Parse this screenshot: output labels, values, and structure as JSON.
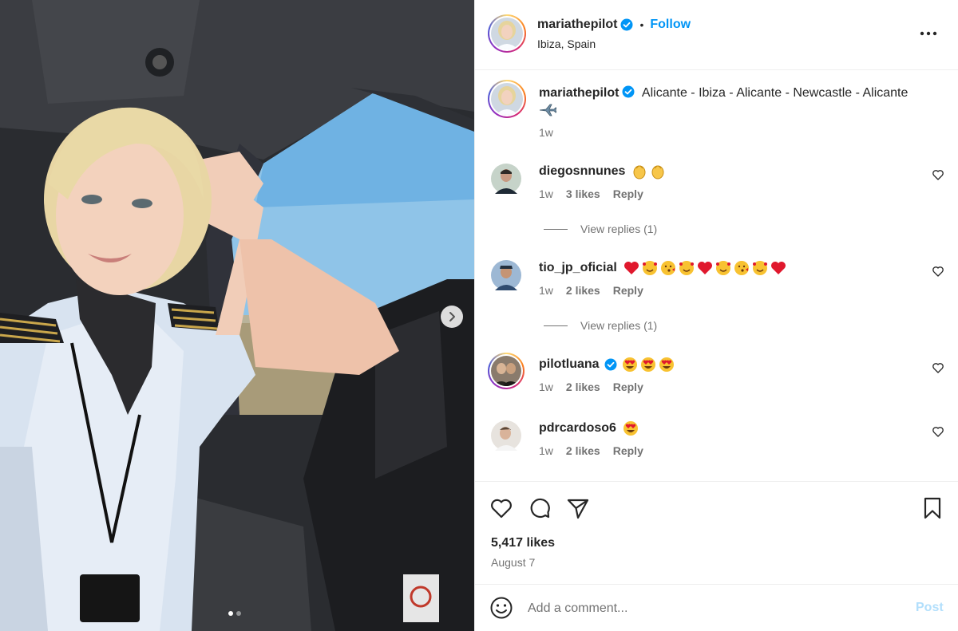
{
  "colors": {
    "accent": "#0095f6",
    "verified": "#0095f6",
    "muted": "#737373",
    "post_disabled": "#b2dffc"
  },
  "photo": {
    "alt_icon": "cockpit-selfie-photo",
    "carousel_dots": 2,
    "active_dot": 0
  },
  "header": {
    "username": "mariathepilot",
    "separator": "•",
    "follow_label": "Follow",
    "location": "Ibiza, Spain"
  },
  "caption": {
    "username": "mariathepilot",
    "text": "Alicante - Ibiza - Alicante - Newcastle - Alicante",
    "emoji": "airplane-emoji",
    "time": "1w"
  },
  "comments": [
    {
      "username": "diegosnnunes",
      "verified": false,
      "emojis": [
        "clapping-hands",
        "clapping-hands"
      ],
      "time": "1w",
      "likes": "3 likes",
      "reply_label": "Reply",
      "view_replies": "View replies (1)"
    },
    {
      "username": "tio_jp_oficial",
      "verified": false,
      "emojis": [
        "red-heart",
        "smiling-hearts",
        "kissing",
        "smiling-hearts",
        "red-heart",
        "smiling-hearts",
        "kissing",
        "smiling-hearts",
        "red-heart"
      ],
      "time": "1w",
      "likes": "2 likes",
      "reply_label": "Reply",
      "view_replies": "View replies (1)"
    },
    {
      "username": "pilotluana",
      "verified": true,
      "emojis": [
        "heart-eyes",
        "heart-eyes",
        "heart-eyes"
      ],
      "time": "1w",
      "likes": "2 likes",
      "reply_label": "Reply"
    },
    {
      "username": "pdrcardoso6",
      "verified": false,
      "emojis": [
        "heart-eyes"
      ],
      "time": "1w",
      "likes": "2 likes",
      "reply_label": "Reply"
    }
  ],
  "actions": {
    "likes": "5,417 likes",
    "date": "August 7"
  },
  "comment_box": {
    "placeholder": "Add a comment...",
    "post_label": "Post"
  }
}
